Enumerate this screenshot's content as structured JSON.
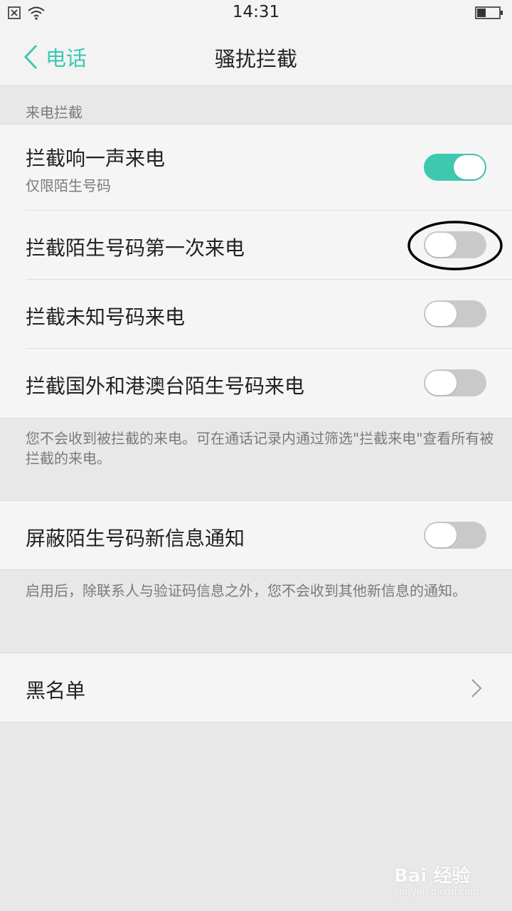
{
  "status_bar": {
    "time": "14:31"
  },
  "nav": {
    "back_label": "电话",
    "title": "骚扰拦截"
  },
  "section_call_block": {
    "header": "来电拦截",
    "items": [
      {
        "title": "拦截响一声来电",
        "subtitle": "仅限陌生号码",
        "toggle_on": true
      },
      {
        "title": "拦截陌生号码第一次来电",
        "toggle_on": false
      },
      {
        "title": "拦截未知号码来电",
        "toggle_on": false
      },
      {
        "title": "拦截国外和港澳台陌生号码来电",
        "toggle_on": false
      }
    ],
    "footnote": "您不会收到被拦截的来电。可在通话记录内通过筛选\"拦截来电\"查看所有被拦截的来电。"
  },
  "section_message": {
    "item": {
      "title": "屏蔽陌生号码新信息通知",
      "toggle_on": false
    },
    "footnote": "启用后，除联系人与验证码信息之外，您不会收到其他新信息的通知。"
  },
  "blacklist": {
    "title": "黑名单"
  },
  "watermark": {
    "main": "Bai 经验",
    "sub": "jingyan.baidu.com"
  },
  "colors": {
    "accent": "#3ec8b0",
    "toggle_off": "#c9c9c9",
    "background": "#e8e8e8",
    "row_bg": "#f5f5f5"
  }
}
